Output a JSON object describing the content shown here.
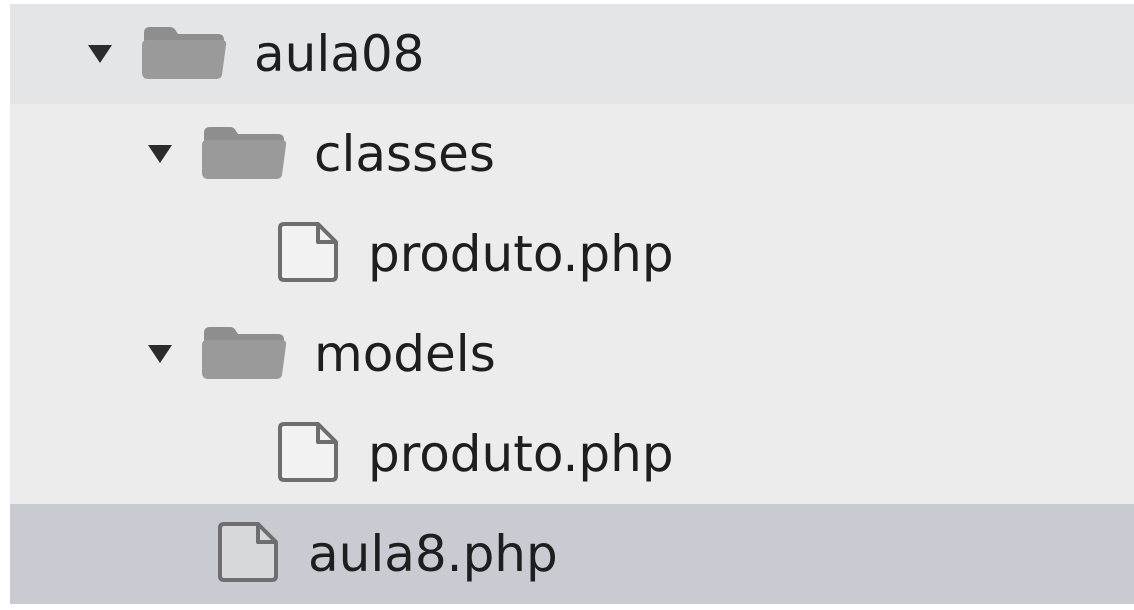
{
  "tree": {
    "items": [
      {
        "label": "aula08",
        "type": "folder",
        "icon": "folder-icon",
        "expanded": true,
        "state": "hover"
      },
      {
        "label": "classes",
        "type": "folder",
        "icon": "folder-icon",
        "expanded": true,
        "state": "normal"
      },
      {
        "label": "produto.php",
        "type": "file",
        "icon": "file-icon",
        "state": "normal"
      },
      {
        "label": "models",
        "type": "folder",
        "icon": "folder-icon",
        "expanded": true,
        "state": "normal"
      },
      {
        "label": "produto.php",
        "type": "file",
        "icon": "file-icon",
        "state": "normal"
      },
      {
        "label": "aula8.php",
        "type": "file",
        "icon": "file-icon",
        "state": "selected"
      }
    ]
  },
  "colors": {
    "panel_bg": "#ececec",
    "hover_bg": "#e3e5e7",
    "selected_bg": "#c8ccd2",
    "icon_gray": "#9a9a9a",
    "text": "#1e1e1e"
  }
}
